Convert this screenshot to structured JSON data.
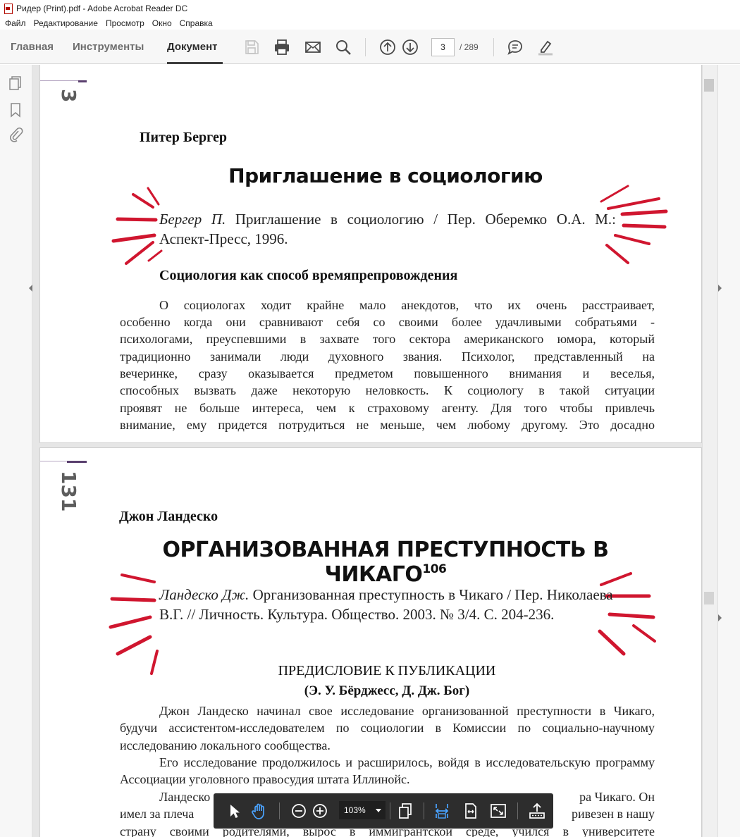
{
  "window": {
    "title": "Ридер (Print).pdf - Adobe Acrobat Reader DC"
  },
  "menu": [
    "Файл",
    "Редактирование",
    "Просмотр",
    "Окно",
    "Справка"
  ],
  "tabs": {
    "home": "Главная",
    "tools": "Инструменты",
    "document": "Документ"
  },
  "toolbar": {
    "current_page": "3",
    "page_total": "/ 289"
  },
  "page1": {
    "page_number": "3",
    "author": "Питер Бергер",
    "title": "Приглашение в социологию",
    "citation_author": "Бергер П.",
    "citation_rest": " Приглашение в социологию / Пер. Оберемко О.А. М.: Аспект-Пресс, 1996.",
    "section_heading": "Социология как способ времяпрепровождения",
    "lines": [
      "О социологах ходит крайне мало анекдотов, что их очень расстраивает,",
      "особенно когда они сравнивают себя со своими более удачливыми собратьями -",
      "психологами, преуспевшими в захвате того сектора американского юмора, который",
      "традиционно занимали люди духовного звания. Психолог, представленный на",
      "вечеринке, сразу оказывается предметом повышенного внимания и веселья,",
      "способных вызвать даже некоторую неловкость. К социологу в такой ситуации",
      "проявят не больше интереса, чем к страховому агенту. Для того чтобы привлечь",
      "внимание, ему придется потрудиться не меньше, чем любому другому. Это досадно"
    ]
  },
  "page2": {
    "page_number": "131",
    "author": "Джон Ландеско",
    "title": "ОРГАНИЗОВАННАЯ ПРЕСТУПНОСТЬ В ЧИКАГО",
    "title_footnote": "106",
    "citation_author": "Ландеско Дж.",
    "citation_rest": " Организованная преступность в Чикаго / Пер. Николаева В.Г. // Личность. Культура. Общество. 2003. № 3/4. С. 204-236.",
    "preface_heading": "ПРЕДИСЛОВИЕ К ПУБЛИКАЦИИ",
    "preface_authors": "(Э. У. Бёрджесс, Д. Дж. Бог)",
    "para1": "Джон Ландеско начинал свое исследование организованной преступности в Чикаго, будучи ассистентом-исследователем по социологии в Комиссии по социально-научному исследованию локального сообщества.",
    "para2": "Его исследование продолжилось и расширилось, войдя в исследовательскую программу Ассоциации уголовного правосудия штата Иллинойс.",
    "para3_line1_left": "Ландеско",
    "para3_line1_right": "ра Чикаго. Он",
    "para3_line2_left": "имел за плеча",
    "para3_line2_right": "ривезен в нашу",
    "para3_line3": "страну своими родителями, вырос в иммигрантской среде, учился в университете"
  },
  "floating_toolbar": {
    "zoom": "103%"
  },
  "colors": {
    "accent_purple": "#5a3f6e",
    "burst_red": "#d0162f",
    "float_bg": "#2d2d2d",
    "highlight_blue": "#4aa3ff"
  }
}
